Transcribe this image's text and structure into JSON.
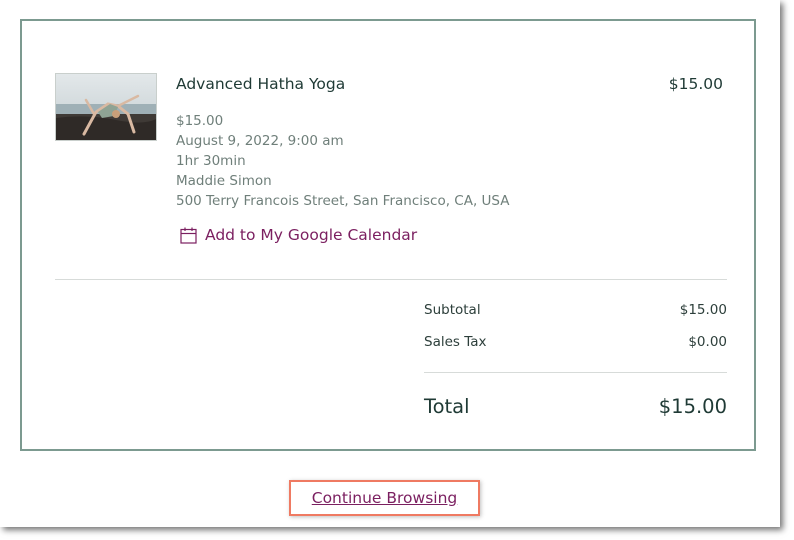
{
  "order_item": {
    "title": "Advanced Hatha Yoga",
    "price": "$15.00",
    "details": [
      "$15.00",
      "August 9, 2022, 9:00 am",
      "1hr 30min",
      "Maddie Simon",
      "500 Terry Francois Street, San Francisco, CA, USA"
    ],
    "calendar_link": "Add to My Google Calendar"
  },
  "summary": {
    "subtotal_label": "Subtotal",
    "subtotal_value": "$15.00",
    "tax_label": "Sales Tax",
    "tax_value": "$0.00",
    "total_label": "Total",
    "total_value": "$15.00"
  },
  "footer": {
    "continue_label": "Continue Browsing"
  },
  "icons": {
    "calendar": "calendar-icon"
  },
  "colors": {
    "accent": "#7b1f60",
    "card_border": "#7c9a90",
    "highlight": "#ef7a62",
    "heading": "#1f3a35",
    "muted": "#6f7f7a"
  }
}
